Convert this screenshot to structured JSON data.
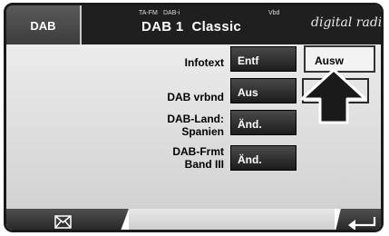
{
  "header": {
    "source": "DAB",
    "tag_ta_fm": "TA-FM",
    "tag_dab_i": "DAB-i",
    "tag_vbd": "Vbd",
    "station": "DAB 1  Classic",
    "brand": "digital radio"
  },
  "settings": {
    "infotext": {
      "label": "Infotext",
      "option_entf": "Entf",
      "option_ausw": "Ausw"
    },
    "dab_vrbnd": {
      "label": "DAB vrbnd",
      "value": "Aus"
    },
    "dab_land": {
      "label_line1": "DAB-Land:",
      "label_line2": "Spanien",
      "action": "Änd."
    },
    "dab_frmt": {
      "label_line1": "DAB-Frmt",
      "label_line2": "Band III",
      "action": "Änd."
    }
  },
  "footer": {
    "message_icon": "envelope-icon",
    "back_icon": "return-arrow-icon"
  },
  "colors": {
    "background": "#dedede",
    "header": "#1f1f1f",
    "button": "#2a2a2a"
  }
}
